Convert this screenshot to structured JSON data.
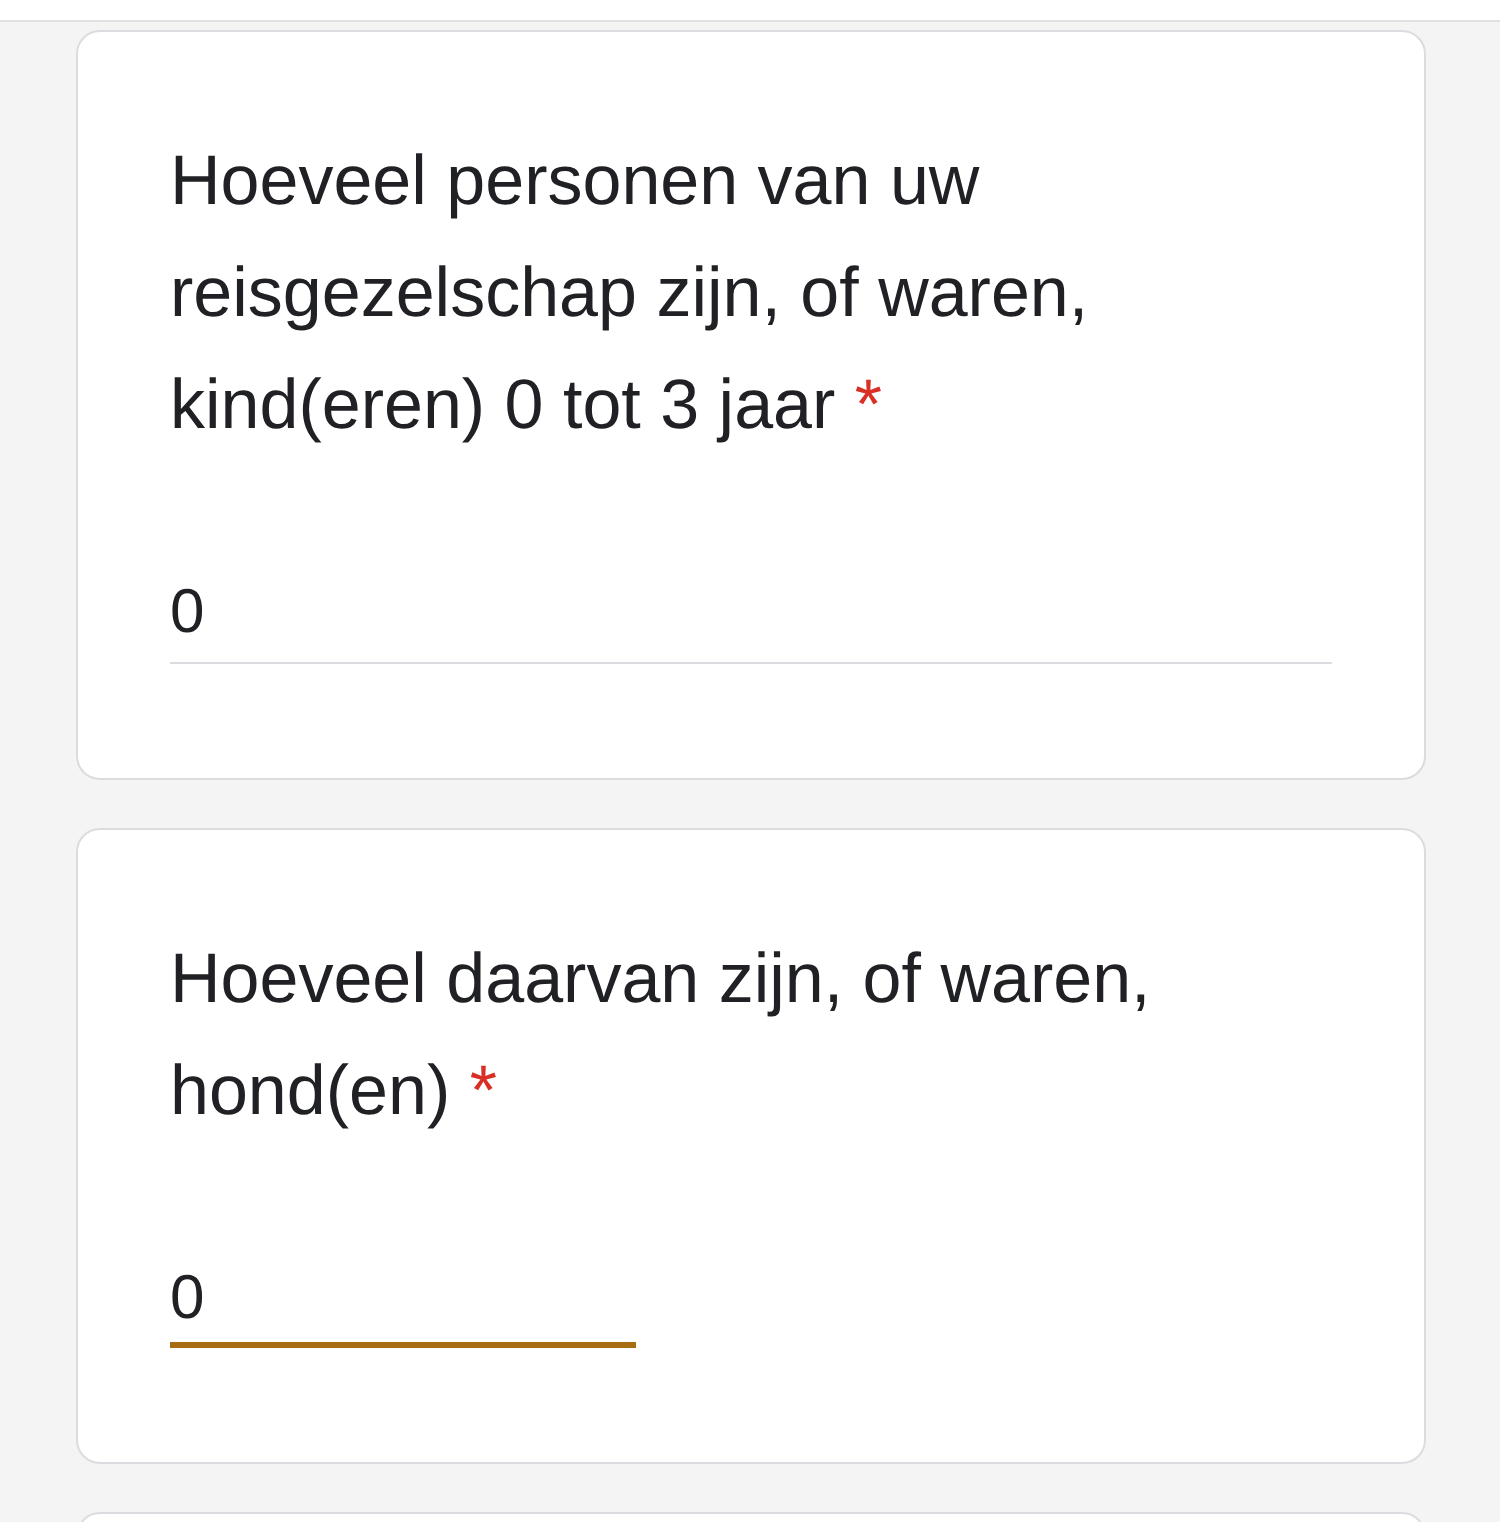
{
  "questions": [
    {
      "title": "Hoeveel personen van uw reisgezelschap zijn, of waren, kind(eren) 0 tot 3 jaar",
      "required_mark": "*",
      "answer": {
        "value": "0",
        "focused": false
      }
    },
    {
      "title": "Hoeveel daarvan zijn, of waren, hond(en)",
      "required_mark": "*",
      "answer": {
        "value": "0",
        "focused": true
      }
    }
  ]
}
